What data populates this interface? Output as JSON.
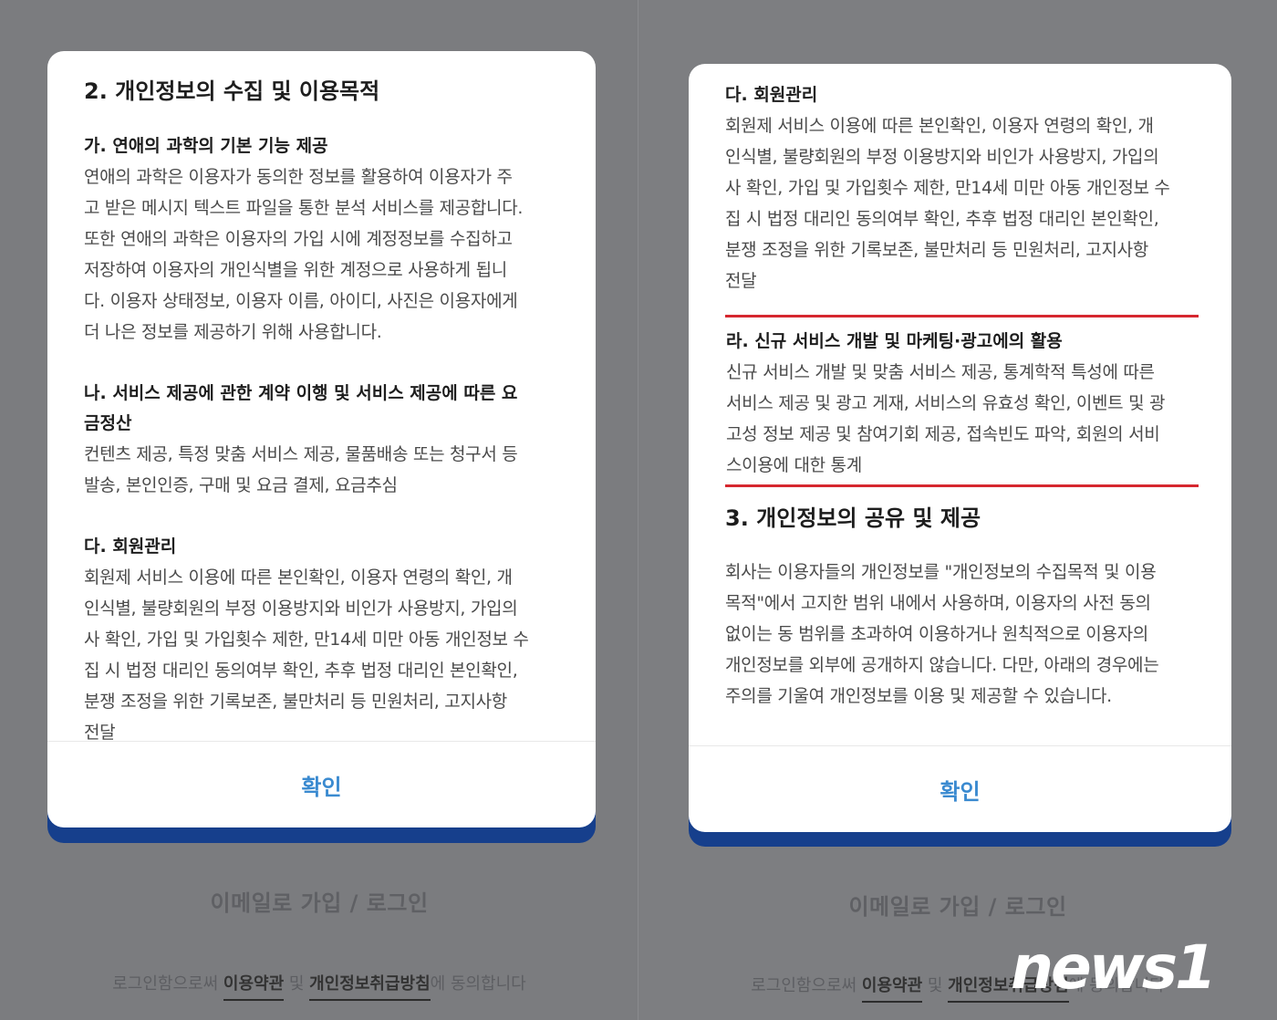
{
  "left": {
    "heading": "2. 개인정보의 수집 및 이용목적",
    "sections": [
      {
        "title": "가. 연애의 과학의 기본 기능 제공",
        "lines": [
          "연애의 과학은 이용자가 동의한 정보를 활용하여 이용자가 주",
          "고 받은 메시지 텍스트 파일을 통한 분석 서비스를 제공합니다.",
          "또한 연애의 과학은 이용자의 가입 시에 계정정보를 수집하고",
          "저장하여 이용자의 개인식별을 위한 계정으로 사용하게 됩니",
          "다. 이용자 상태정보, 이용자 이름, 아이디, 사진은 이용자에게",
          "더 나은 정보를 제공하기 위해 사용합니다."
        ]
      },
      {
        "title_lines": [
          "나. 서비스 제공에 관한 계약 이행 및 서비스 제공에 따른 요",
          "금정산"
        ],
        "lines": [
          "컨텐츠 제공, 특정 맞춤 서비스 제공, 물품배송 또는 청구서 등",
          "발송, 본인인증, 구매 및 요금 결제, 요금추심"
        ]
      },
      {
        "title": "다. 회원관리",
        "lines": [
          "회원제 서비스 이용에 따른 본인확인, 이용자 연령의 확인, 개",
          "인식별, 불량회원의 부정 이용방지와 비인가 사용방지, 가입의",
          "사 확인, 가입 및 가입횟수 제한, 만14세 미만 아동 개인정보 수",
          "집 시 법정 대리인 동의여부 확인, 추후 법정 대리인 본인확인,",
          "분쟁 조정을 위한 기록보존, 불만처리 등 민원처리, 고지사항",
          "전달"
        ]
      }
    ],
    "confirm_label": "확인"
  },
  "right": {
    "section_da": {
      "title": "다. 회원관리",
      "lines": [
        "회원제 서비스 이용에 따른 본인확인, 이용자 연령의 확인, 개",
        "인식별, 불량회원의 부정 이용방지와 비인가 사용방지, 가입의",
        "사 확인, 가입 및 가입횟수 제한, 만14세 미만 아동 개인정보 수",
        "집 시 법정 대리인 동의여부 확인, 추후 법정 대리인 본인확인,",
        "분쟁 조정을 위한 기록보존, 불만처리 등 민원처리, 고지사항",
        "전달"
      ]
    },
    "section_ra": {
      "title": "라. 신규 서비스 개발 및 마케팅·광고에의 활용",
      "lines": [
        "신규 서비스 개발 및 맞춤 서비스 제공, 통계학적 특성에 따른",
        "서비스 제공 및 광고 게재, 서비스의 유효성 확인, 이벤트 및 광",
        "고성 정보 제공 및 참여기회 제공, 접속빈도 파악, 회원의 서비",
        "스이용에 대한 통계"
      ]
    },
    "heading3": "3. 개인정보의 공유 및 제공",
    "para3_lines": [
      "회사는 이용자들의 개인정보를 \"개인정보의 수집목적 및 이용",
      "목적\"에서 고지한 범위 내에서 사용하며, 이용자의 사전 동의",
      "없이는 동 범위를 초과하여 이용하거나 원칙적으로 이용자의",
      "개인정보를 외부에 공개하지 않습니다. 다만, 아래의 경우에는",
      "주의를 기울여 개인정보를 이용 및 제공할 수 있습니다."
    ],
    "confirm_label": "확인"
  },
  "background": {
    "email_login": "이메일로 가입 / 로그인",
    "terms_prefix": "로그인함으로써 ",
    "terms_link1": "이용약관",
    "terms_mid": " 및 ",
    "terms_link2": "개인정보취급방침",
    "terms_suffix": "에 동의합니다"
  },
  "watermark": "news1",
  "colors": {
    "highlight_border": "#d6272f",
    "confirm_text": "#3a8ad0",
    "button_shadow": "#163f8c",
    "overlay": "#7b7c7f"
  }
}
